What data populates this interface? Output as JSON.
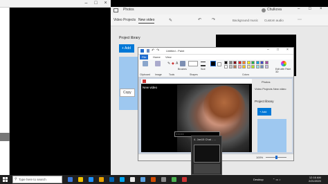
{
  "desktop": {
    "left_window": {
      "min": "–",
      "max": "□",
      "close": "×"
    }
  },
  "photos": {
    "title": "Photos",
    "user": "Chulkova",
    "tabs": [
      "Video Projects",
      "New video"
    ],
    "toolbar_items": [
      "Background music",
      "Custom audio"
    ],
    "project_library": "Project library",
    "add_label": "+ Add",
    "copy_label": "Copy"
  },
  "paint": {
    "title": "Untitled - Paint",
    "tabs": [
      "File",
      "Home",
      "View"
    ],
    "ribbon_labels": [
      "Clipboard",
      "Image",
      "Tools",
      "Brushes",
      "Shapes",
      "Size",
      "Colors",
      "Edit with Paint 3D"
    ],
    "zoom": "100%",
    "palette": [
      "#000000",
      "#7f7f7f",
      "#880015",
      "#ed1c24",
      "#ff7f27",
      "#fff200",
      "#22b14c",
      "#00a2e8",
      "#3f48cc",
      "#a349a4",
      "#ffffff",
      "#c3c3c3",
      "#b97a57",
      "#ffaec9",
      "#ffc90e",
      "#efe4b0",
      "#b5e61d",
      "#99d9ea",
      "#7092be",
      "#c8bfe7"
    ]
  },
  "inner": {
    "new_video": "New video",
    "photos_title": "Photos",
    "tabs": "Video Projects   New video",
    "project_library": "Project library",
    "add_label": "+ Add"
  },
  "thumbnail": {
    "title": "4. Jan15 Chat - ..."
  },
  "taskbar": {
    "search_placeholder": "Type here to search",
    "desktop_label": "Desktop",
    "time": "12:16 AM",
    "date": "2/21/2020",
    "app_colors": [
      "#3c78d8",
      "#f0c000",
      "#1e90ff",
      "#e8a000",
      "#0063b1",
      "#00a4ef",
      "#e8e8e8",
      "#5aa0e0",
      "#d04a02",
      "#888888",
      "#4caf50",
      "#cc3333"
    ]
  }
}
